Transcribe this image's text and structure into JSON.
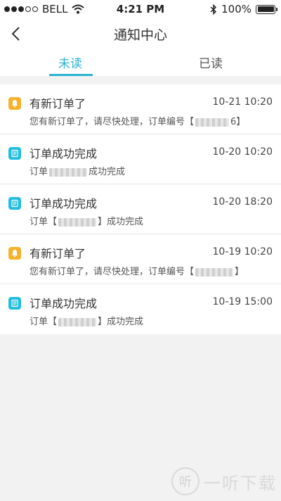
{
  "status_bar": {
    "carrier": "BELL",
    "time": "4:21 PM",
    "battery": "100%",
    "battery_fraction": 1.0
  },
  "nav": {
    "title": "通知中心"
  },
  "tabs": [
    {
      "label": "未读",
      "active": true
    },
    {
      "label": "已读",
      "active": false
    }
  ],
  "notifications": [
    {
      "icon": "bell-icon",
      "title": "有新订单了",
      "time": "10-21 10:20",
      "desc_before": "您有新订单了，请尽快处理，订单编号【",
      "desc_after": "6】"
    },
    {
      "icon": "document-icon",
      "title": "订单成功完成",
      "time": "10-20 10:20",
      "desc_before": "订单",
      "desc_after": "成功完成"
    },
    {
      "icon": "document-icon",
      "title": "订单成功完成",
      "time": "10-20 18:20",
      "desc_before": "订单【",
      "desc_after": "】成功完成"
    },
    {
      "icon": "bell-icon",
      "title": "有新订单了",
      "time": "10-19 10:20",
      "desc_before": "您有新订单了，请尽快处理，订单编号【",
      "desc_after": "】"
    },
    {
      "icon": "document-icon",
      "title": "订单成功完成",
      "time": "10-19 15:00",
      "desc_before": "订单【",
      "desc_after": "】成功完成"
    }
  ],
  "watermark": {
    "logo": "听",
    "text": "一听下载"
  },
  "colors": {
    "accent": "#2bb3d1",
    "bell_icon": "#f6b22b",
    "document_icon": "#22bde0",
    "background": "#f2f2f2"
  }
}
